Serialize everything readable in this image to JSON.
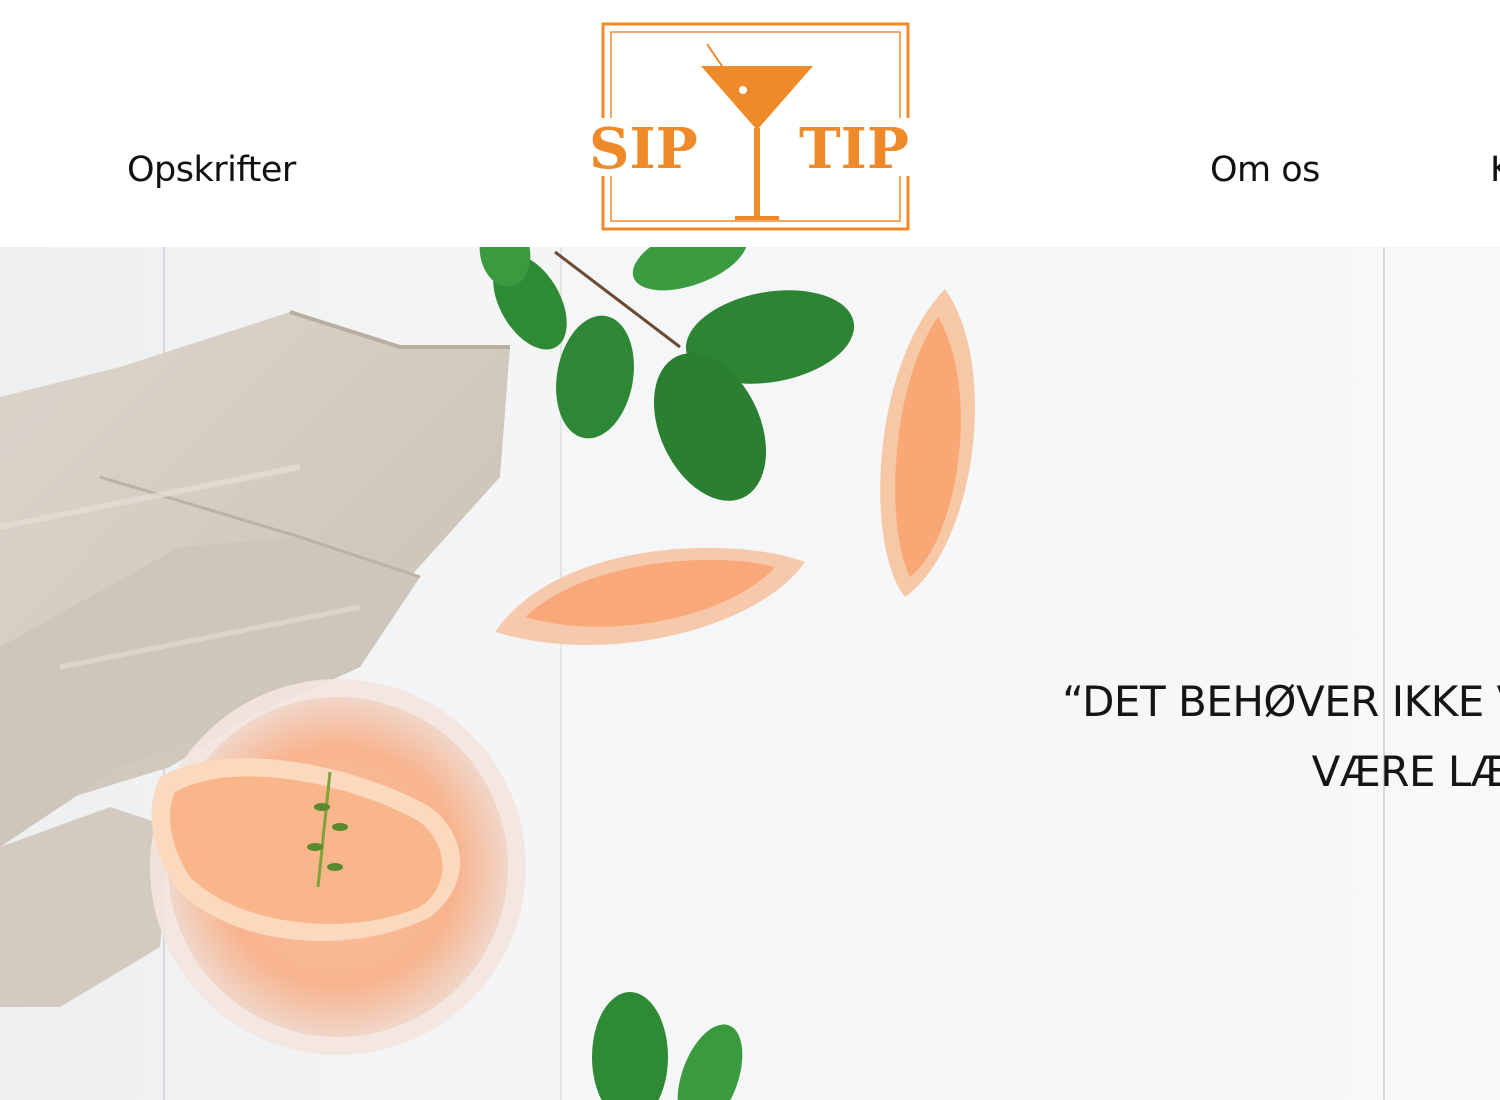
{
  "header": {
    "nav_left": [
      {
        "label": "Opskrifter"
      }
    ],
    "nav_right": [
      {
        "label": "Om os"
      },
      {
        "label": "K"
      }
    ],
    "logo": {
      "text_left": "SIP",
      "text_right": "TIP",
      "color": "#ef8a2a"
    }
  },
  "hero": {
    "quote_line1": "“DET BEHØVER IKKE VÆRE",
    "quote_line2": "VÆRE LÆKKER"
  }
}
